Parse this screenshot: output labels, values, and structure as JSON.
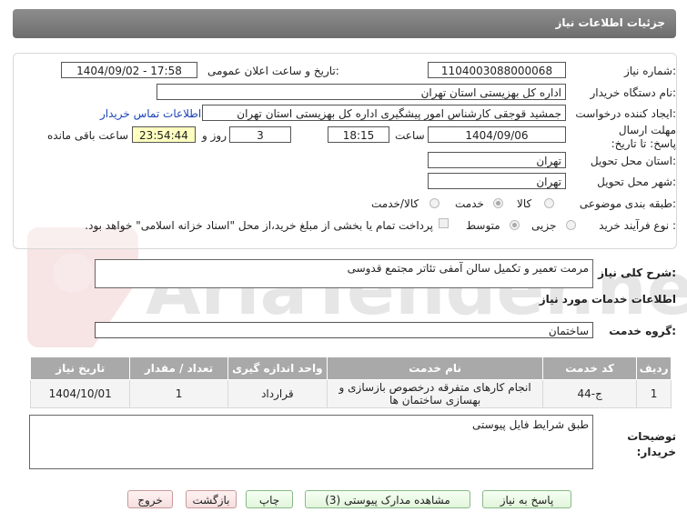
{
  "header": {
    "title": "جزئیات اطلاعات نیاز"
  },
  "watermark": {
    "text": "AriaTender.net"
  },
  "fields": {
    "need_number_label": "شماره نیاز:",
    "need_number": "1104003088000068",
    "announce_label": "تاریخ و ساعت اعلان عمومی:",
    "announce_value": "1404/09/02 - 17:58",
    "buyer_org_label": "نام دستگاه خریدار:",
    "buyer_org": "اداره کل بهزیستی استان تهران",
    "creator_label": "ایجاد کننده درخواست:",
    "creator": "جمشید قوجقی کارشناس امور پیشگیری اداره کل بهزیستی استان تهران",
    "contact_link": "اطلاعات تماس خریدار",
    "deadline_label": "مهلت ارسال پاسخ: تا تاریخ:",
    "deadline_date": "1404/09/06",
    "time_label": "ساعت",
    "deadline_time": "18:15",
    "days_value": "3",
    "days_label": "روز و",
    "remaining_time": "23:54:44",
    "remaining_label": "ساعت باقی مانده",
    "province_label": "استان محل تحویل:",
    "province": "تهران",
    "city_label": "شهر محل تحویل:",
    "city": "تهران",
    "category_label": "طبقه بندی موضوعی:",
    "category_options": [
      "کالا",
      "خدمت",
      "کالا/خدمت"
    ],
    "purchase_type_label": "نوع فرآیند خرید :",
    "purchase_options": [
      "جزیی",
      "متوسط"
    ],
    "payment_note": "پرداخت تمام یا بخشی از مبلغ خرید،از محل \"اسناد خزانه اسلامی\" خواهد بود."
  },
  "need": {
    "summary_label": "شرح کلی نیاز:",
    "summary": "مرمت تعمیر و تکمیل سالن آمفی تئاتر مجتمع قدوسی",
    "services_heading": "اطلاعات خدمات مورد نیاز",
    "group_label": "گروه خدمت:",
    "group_value": "ساختمان"
  },
  "table": {
    "headers": [
      "ردیف",
      "کد خدمت",
      "نام خدمت",
      "واحد اندازه گیری",
      "تعداد / مقدار",
      "تاریخ نیاز"
    ],
    "rows": [
      [
        "1",
        "ج-44",
        "انجام کارهای متفرقه درخصوص بازسازی و بهسازی ساختمان ها",
        "قرارداد",
        "1",
        "1404/10/01"
      ]
    ]
  },
  "notes": {
    "label": "توضیحات خریدار:",
    "value": "طبق شرایط فایل پیوستی"
  },
  "buttons": {
    "reply": "پاسخ به نیاز",
    "attachments": "مشاهده مدارک پیوستی (3)",
    "print": "چاپ",
    "back": "بازگشت",
    "exit": "خروج"
  },
  "colors": {
    "header": "#7d7d7d",
    "table_header": "#a9a9a9",
    "link": "#1a44b8",
    "countdown_bg": "#ffffc0"
  }
}
